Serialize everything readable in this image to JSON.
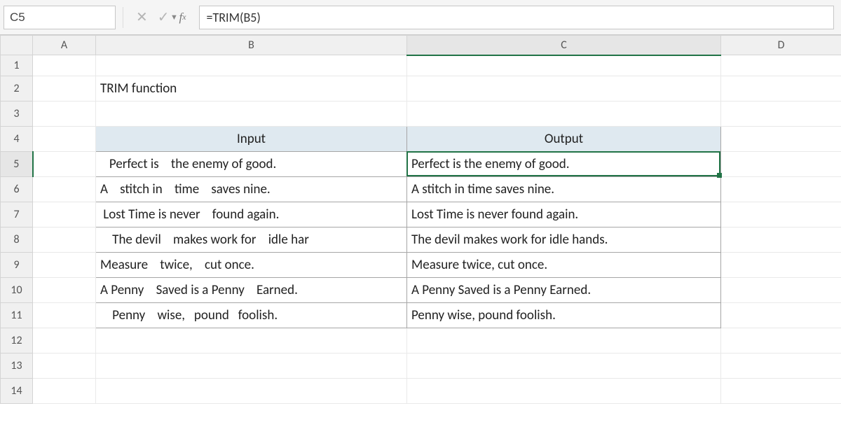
{
  "formula_bar": {
    "name_box": "C5",
    "formula": "=TRIM(B5)"
  },
  "columns": [
    "A",
    "B",
    "C",
    "D"
  ],
  "row_headers": [
    "1",
    "2",
    "3",
    "4",
    "5",
    "6",
    "7",
    "8",
    "9",
    "10",
    "11",
    "12",
    "13",
    "14"
  ],
  "selected_col_idx": 2,
  "selected_row_idx": 4,
  "title": "TRIM function",
  "table": {
    "headers": {
      "input": "Input",
      "output": "Output"
    },
    "rows": [
      {
        "input": "   Perfect is    the enemy of good.",
        "output": "Perfect is the enemy of good."
      },
      {
        "input": "A    stitch in    time    saves nine.",
        "output": "A stitch in time saves nine."
      },
      {
        "input": " Lost Time is never    found again.",
        "output": "Lost Time is never found again."
      },
      {
        "input": "    The devil    makes work for    idle har",
        "output": "The devil makes work for idle hands."
      },
      {
        "input": "Measure    twice,    cut once.",
        "output": "Measure twice, cut once."
      },
      {
        "input": "A Penny    Saved is a Penny    Earned.",
        "output": "A Penny Saved is a Penny Earned."
      },
      {
        "input": "    Penny    wise,   pound   foolish.",
        "output": "Penny wise, pound foolish."
      }
    ]
  }
}
